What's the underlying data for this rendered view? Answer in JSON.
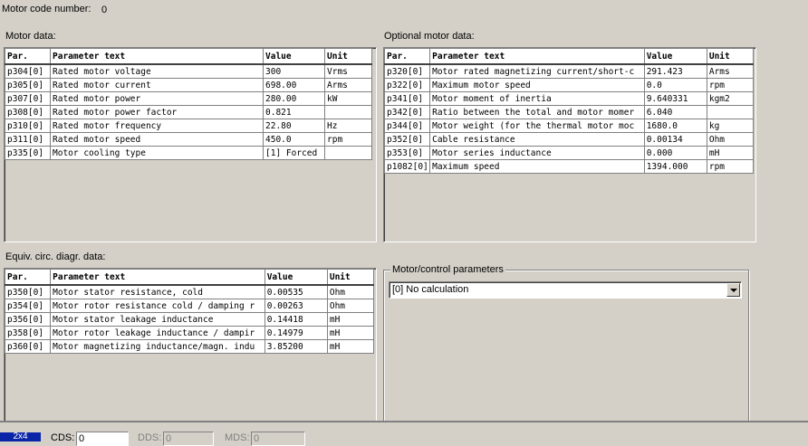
{
  "header": {
    "motor_code_label": "Motor code number:",
    "motor_code_value": "0"
  },
  "motor_data": {
    "title": "Motor data:",
    "columns": [
      "Par.",
      "Parameter text",
      "Value",
      "Unit"
    ],
    "rows": [
      [
        "p304[0]",
        "Rated motor voltage",
        "300",
        "Vrms"
      ],
      [
        "p305[0]",
        "Rated motor current",
        "698.00",
        "Arms"
      ],
      [
        "p307[0]",
        "Rated motor power",
        "280.00",
        "kW"
      ],
      [
        "p308[0]",
        "Rated motor power factor",
        "0.821",
        ""
      ],
      [
        "p310[0]",
        "Rated motor frequency",
        "22.80",
        "Hz"
      ],
      [
        "p311[0]",
        "Rated motor speed",
        "450.0",
        "rpm"
      ],
      [
        "p335[0]",
        "Motor cooling type",
        "[1] Forced",
        ""
      ]
    ]
  },
  "optional_motor_data": {
    "title": "Optional motor data:",
    "columns": [
      "Par.",
      "Parameter text",
      "Value",
      "Unit"
    ],
    "rows": [
      [
        "p320[0]",
        "Motor rated magnetizing current/short-c",
        "291.423",
        "Arms"
      ],
      [
        "p322[0]",
        "Maximum motor speed",
        "0.0",
        "rpm"
      ],
      [
        "p341[0]",
        "Motor moment of inertia",
        "9.640331",
        "kgm2"
      ],
      [
        "p342[0]",
        "Ratio between the total and motor momer",
        "6.040",
        ""
      ],
      [
        "p344[0]",
        "Motor weight (for the thermal motor moc",
        "1680.0",
        "kg"
      ],
      [
        "p352[0]",
        "Cable resistance",
        "0.00134",
        "Ohm"
      ],
      [
        "p353[0]",
        "Motor series inductance",
        "0.000",
        "mH"
      ],
      [
        "p1082[0]",
        "Maximum speed",
        "1394.000",
        "rpm"
      ]
    ]
  },
  "equiv_circ_data": {
    "title": "Equiv. circ. diagr. data:",
    "columns": [
      "Par.",
      "Parameter text",
      "Value",
      "Unit"
    ],
    "rows": [
      [
        "p350[0]",
        "Motor stator resistance, cold",
        "0.00535",
        "Ohm"
      ],
      [
        "p354[0]",
        "Motor rotor resistance cold / damping r",
        "0.00263",
        "Ohm"
      ],
      [
        "p356[0]",
        "Motor stator leakage inductance",
        "0.14418",
        "mH"
      ],
      [
        "p358[0]",
        "Motor rotor leakage inductance / dampir",
        "0.14979",
        "mH"
      ],
      [
        "p360[0]",
        "Motor magnetizing inductance/magn. indu",
        "3.85200",
        "mH"
      ]
    ]
  },
  "motor_control": {
    "title": "Motor/control parameters",
    "selected": "[0] No calculation"
  },
  "status_bar": {
    "tab_label": "2x4",
    "cds_label": "CDS:",
    "cds_value": "0",
    "dds_label": "DDS:",
    "dds_value": "0",
    "mds_label": "MDS:",
    "mds_value": "0"
  },
  "colors": {
    "background": "#d4d0c8",
    "grid_bg": "#ffffff",
    "tab_active": "#0a24a8"
  }
}
